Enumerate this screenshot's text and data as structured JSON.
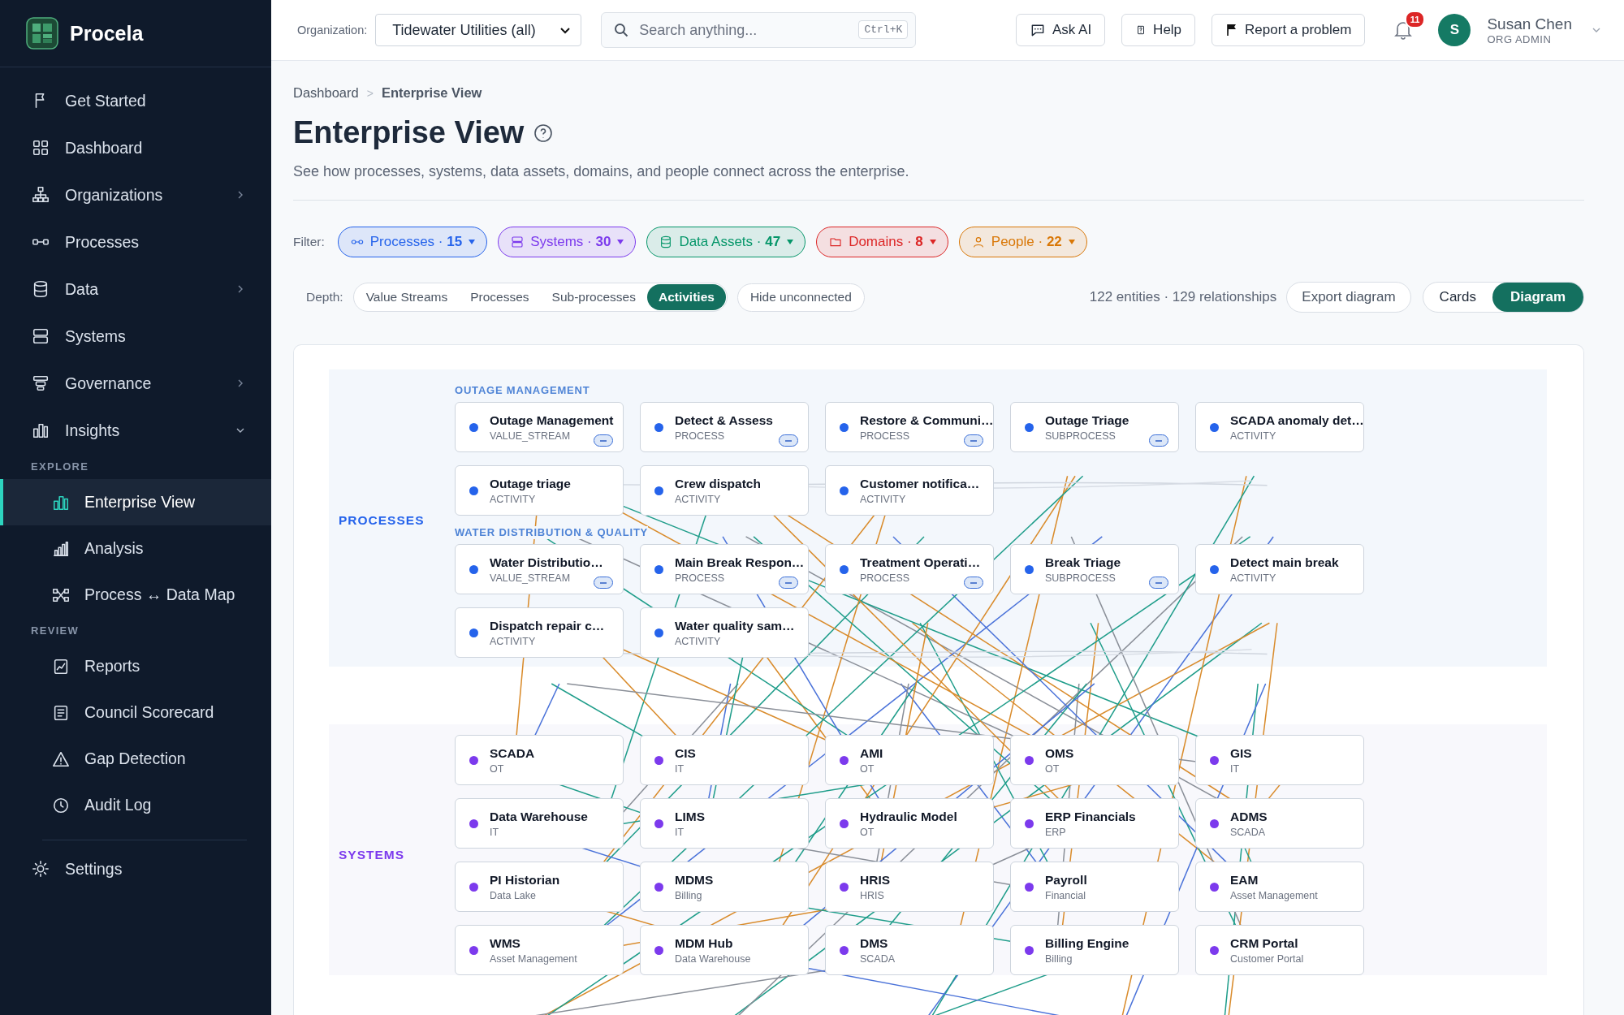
{
  "sidebar": {
    "brand": "Procela",
    "sections": [
      {
        "items": [
          {
            "kind": "link",
            "label": "Get Started",
            "selected": false
          },
          {
            "kind": "link",
            "label": "Dashboard",
            "selected": false
          },
          {
            "kind": "group",
            "label": "Organizations",
            "selected": false,
            "expanded": false
          },
          {
            "kind": "link",
            "label": "Processes",
            "selected": false
          },
          {
            "kind": "group",
            "label": "Data",
            "selected": false,
            "expanded": false
          },
          {
            "kind": "link",
            "label": "Systems",
            "selected": false
          },
          {
            "kind": "group",
            "label": "Governance",
            "selected": false,
            "expanded": false
          },
          {
            "kind": "group",
            "label": "Insights",
            "selected": false,
            "expanded": true
          }
        ]
      },
      {
        "heading": "EXPLORE",
        "items": [
          {
            "kind": "link",
            "label": "Enterprise View",
            "selected": true
          },
          {
            "kind": "link",
            "label": "Analysis",
            "selected": false
          },
          {
            "kind": "link",
            "label": "Process ↔ Data Map",
            "selected": false
          }
        ]
      },
      {
        "heading": "REVIEW",
        "items": [
          {
            "kind": "link",
            "label": "Reports",
            "selected": false
          },
          {
            "kind": "link",
            "label": "Council Scorecard",
            "selected": false
          },
          {
            "kind": "link",
            "label": "Gap Detection",
            "selected": false
          },
          {
            "kind": "link",
            "label": "Audit Log",
            "selected": false
          }
        ]
      },
      {
        "items": [
          {
            "kind": "link",
            "label": "Settings",
            "selected": false
          }
        ]
      }
    ]
  },
  "topbar": {
    "organization_label": "Organization:",
    "organization": "Tidewater Utilities (all)",
    "search": {
      "placeholder": "Search anything...",
      "shortcut": "Ctrl+K"
    },
    "buttons": [
      "Ask AI",
      "Help",
      "Report a problem"
    ],
    "notifications": "11",
    "user": {
      "initial": "S",
      "name": "Susan Chen",
      "role": "ORG ADMIN"
    }
  },
  "breadcrumb_separator": ">",
  "breadcrumb": [
    {
      "label": "Dashboard",
      "current": false
    },
    {
      "label": "Enterprise View",
      "current": true
    }
  ],
  "title": "Enterprise View",
  "description": "See how processes, systems, data assets, domains, and people connect across the enterprise.",
  "filter_label": "Filter:",
  "filters": [
    {
      "label": "Processes ·",
      "count": "15",
      "color": "#2563eb"
    },
    {
      "label": "Systems ·",
      "count": "30",
      "color": "#7c3aed"
    },
    {
      "label": "Data Assets ·",
      "count": "47",
      "color": "#059669"
    },
    {
      "label": "Domains ·",
      "count": "8",
      "color": "#dc2626"
    },
    {
      "label": "People ·",
      "count": "22",
      "color": "#d97706"
    }
  ],
  "depth_label": "Depth:",
  "depth": [
    {
      "label": "Value Streams",
      "selected": false
    },
    {
      "label": "Processes",
      "selected": false
    },
    {
      "label": "Sub-processes",
      "selected": false
    },
    {
      "label": "Activities",
      "selected": true
    }
  ],
  "hide_unconnected": "Hide unconnected",
  "stats": "122 entities · 129 relationships",
  "export": "Export diagram",
  "views": [
    {
      "label": "Cards",
      "selected": false
    },
    {
      "label": "Diagram",
      "selected": true
    }
  ],
  "bands": [
    {
      "label": "PROCESSES",
      "color": "#2563eb",
      "groups": [
        {
          "heading": "OUTAGE MANAGEMENT",
          "nodes": [
            {
              "name": "Outage Management",
              "type": "VALUE_STREAM",
              "collapsible": true
            },
            {
              "name": "Detect & Assess",
              "type": "PROCESS",
              "collapsible": true
            },
            {
              "name": "Restore & Communi…",
              "type": "PROCESS",
              "collapsible": true
            },
            {
              "name": "Outage Triage",
              "type": "SUBPROCESS",
              "collapsible": true
            },
            {
              "name": "SCADA anomaly det…",
              "type": "ACTIVITY",
              "collapsible": false
            },
            {
              "name": "Outage triage",
              "type": "ACTIVITY",
              "collapsible": false
            },
            {
              "name": "Crew dispatch",
              "type": "ACTIVITY",
              "collapsible": false
            },
            {
              "name": "Customer notifica…",
              "type": "ACTIVITY",
              "collapsible": false
            }
          ]
        },
        {
          "heading": "WATER DISTRIBUTION & QUALITY",
          "nodes": [
            {
              "name": "Water Distributio…",
              "type": "VALUE_STREAM",
              "collapsible": true
            },
            {
              "name": "Main Break Respon…",
              "type": "PROCESS",
              "collapsible": true
            },
            {
              "name": "Treatment Operati…",
              "type": "PROCESS",
              "collapsible": true
            },
            {
              "name": "Break Triage",
              "type": "SUBPROCESS",
              "collapsible": true
            },
            {
              "name": "Detect main break",
              "type": "ACTIVITY",
              "collapsible": false
            },
            {
              "name": "Dispatch repair c…",
              "type": "ACTIVITY",
              "collapsible": false
            },
            {
              "name": "Water quality sam…",
              "type": "ACTIVITY",
              "collapsible": false
            }
          ]
        }
      ]
    },
    {
      "label": "SYSTEMS",
      "color": "#7c3aed",
      "groups": [
        {
          "nodes": [
            {
              "name": "SCADA",
              "type": "OT",
              "collapsible": false
            },
            {
              "name": "CIS",
              "type": "IT",
              "collapsible": false
            },
            {
              "name": "AMI",
              "type": "OT",
              "collapsible": false
            },
            {
              "name": "OMS",
              "type": "OT",
              "collapsible": false
            },
            {
              "name": "GIS",
              "type": "IT",
              "collapsible": false
            },
            {
              "name": "Data Warehouse",
              "type": "IT",
              "collapsible": false
            },
            {
              "name": "LIMS",
              "type": "IT",
              "collapsible": false
            },
            {
              "name": "Hydraulic Model",
              "type": "OT",
              "collapsible": false
            },
            {
              "name": "ERP Financials",
              "type": "ERP",
              "collapsible": false
            },
            {
              "name": "ADMS",
              "type": "SCADA",
              "collapsible": false
            },
            {
              "name": "PI Historian",
              "type": "Data Lake",
              "collapsible": false
            },
            {
              "name": "MDMS",
              "type": "Billing",
              "collapsible": false
            },
            {
              "name": "HRIS",
              "type": "HRIS",
              "collapsible": false
            },
            {
              "name": "Payroll",
              "type": "Financial",
              "collapsible": false
            },
            {
              "name": "EAM",
              "type": "Asset Management",
              "collapsible": false
            },
            {
              "name": "WMS",
              "type": "Asset Management",
              "collapsible": false
            },
            {
              "name": "MDM Hub",
              "type": "Data Warehouse",
              "collapsible": false
            },
            {
              "name": "DMS",
              "type": "SCADA",
              "collapsible": false
            },
            {
              "name": "Billing Engine",
              "type": "Billing",
              "collapsible": false
            },
            {
              "name": "CRM Portal",
              "type": "Customer Portal",
              "collapsible": false
            }
          ]
        }
      ]
    }
  ]
}
